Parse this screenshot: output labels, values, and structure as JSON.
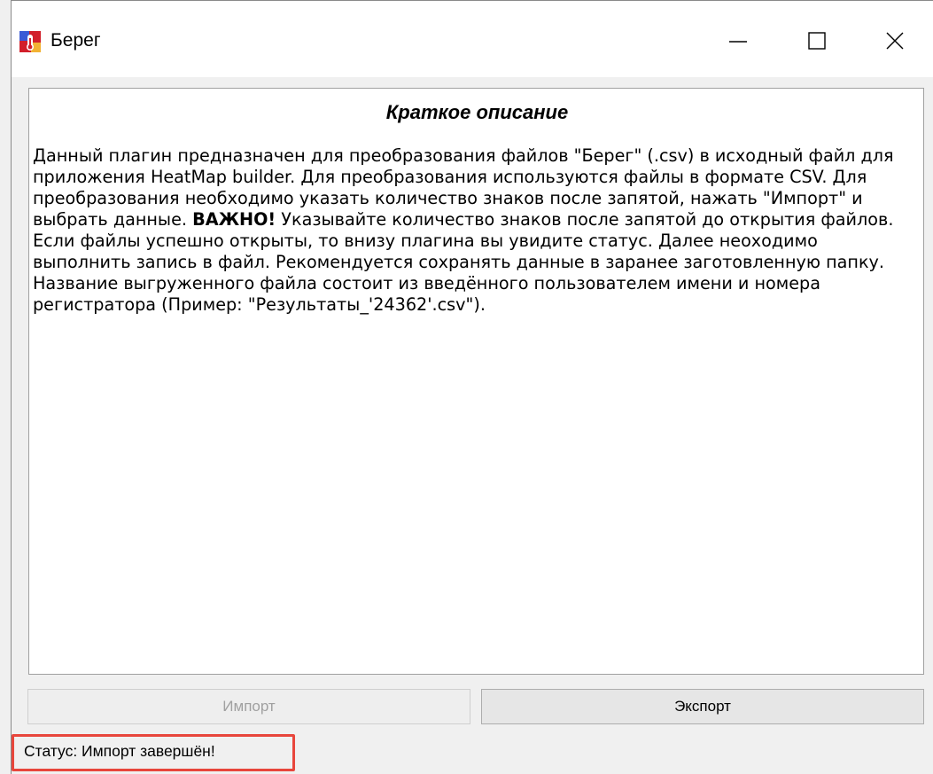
{
  "window": {
    "title": "Берег",
    "controls": {
      "minimize": "minimize-icon",
      "maximize": "maximize-icon",
      "close": "close-icon"
    }
  },
  "description": {
    "heading": "Краткое описание",
    "part1": "Данный плагин предназначен для преобразования файлов \"Берег\" (.csv) в исходный файл для приложения HeatMap builder. Для преобразования используются файлы в формате CSV. Для преобразования необходимо указать количество знаков после запятой, нажать \"Импорт\" и выбрать данные. ",
    "important": "ВАЖНО!",
    "part2": " Указывайте количество знаков после запятой до открытия файлов. Если файлы успешно открыты, то внизу плагина вы увидите статус. Далее неоходимо выполнить запись в файл. Рекомендуется сохранять данные в заранее заготовленную папку. Название выгруженного файла состоит из введённого пользователем имени и  номера регистратора (Пример: \"Результаты_'24362'.csv\")."
  },
  "buttons": {
    "import_label": "Импорт",
    "export_label": "Экспорт"
  },
  "status": {
    "text": "Статус: Импорт завершён!"
  },
  "colors": {
    "status_highlight": "#e8463c",
    "window_bg": "#f0f0f0"
  }
}
